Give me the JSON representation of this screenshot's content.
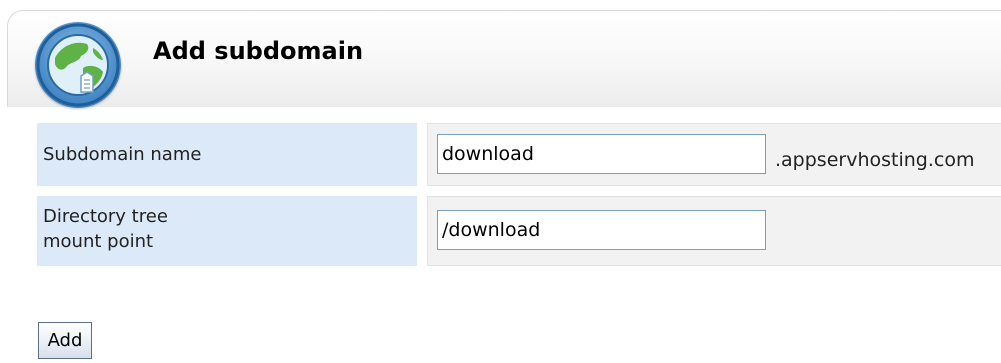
{
  "header": {
    "title": "Add subdomain",
    "icon": "globe-icon"
  },
  "form": {
    "subdomain": {
      "label": "Subdomain name",
      "value": "download",
      "suffix": ".appservhosting.com"
    },
    "mount_point": {
      "label_line1": "Directory tree",
      "label_line2": "mount point",
      "value": "/download"
    }
  },
  "actions": {
    "add_label": "Add"
  },
  "colors": {
    "label_background": "#dce9f8",
    "field_background": "#f2f2f2",
    "input_border": "#7a9ebd"
  }
}
